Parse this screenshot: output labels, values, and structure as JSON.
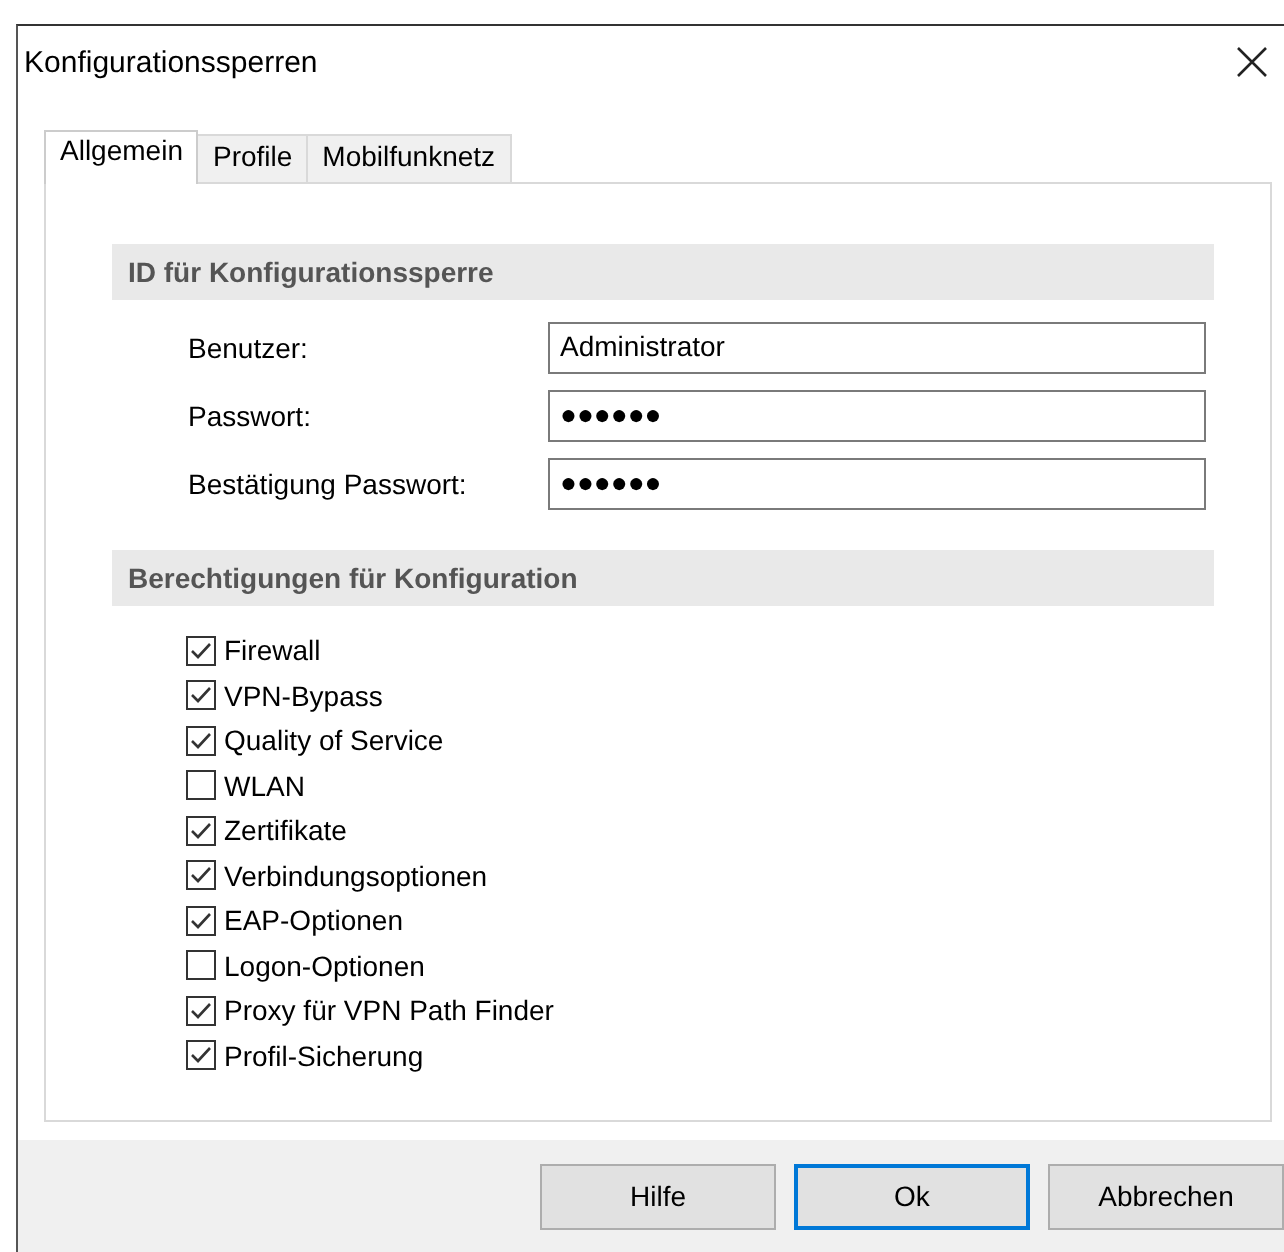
{
  "window": {
    "title": "Konfigurationssperren"
  },
  "tabs": [
    {
      "label": "Allgemein",
      "selected": true
    },
    {
      "label": "Profile",
      "selected": false
    },
    {
      "label": "Mobilfunknetz",
      "selected": false
    }
  ],
  "id_section": {
    "title": "ID für Konfigurationssperre",
    "fields": [
      {
        "label": "Benutzer:",
        "value": "Administrator"
      },
      {
        "label": "Passwort:",
        "value": "●●●●●●"
      },
      {
        "label": "Bestätigung Passwort:",
        "value": "●●●●●●"
      }
    ]
  },
  "permissions": {
    "title": "Berechtigungen für Konfiguration",
    "items": [
      {
        "label": "Firewall",
        "checked": true
      },
      {
        "label": "VPN-Bypass",
        "checked": true
      },
      {
        "label": "Quality of Service",
        "checked": true
      },
      {
        "label": "WLAN",
        "checked": false
      },
      {
        "label": "Zertifikate",
        "checked": true
      },
      {
        "label": "Verbindungsoptionen",
        "checked": true
      },
      {
        "label": "EAP-Optionen",
        "checked": true
      },
      {
        "label": "Logon-Optionen",
        "checked": false
      },
      {
        "label": "Proxy für VPN Path Finder",
        "checked": true
      },
      {
        "label": "Profil-Sicherung",
        "checked": true
      }
    ]
  },
  "buttons": [
    {
      "label": "Hilfe",
      "default": false
    },
    {
      "label": "Ok",
      "default": true
    },
    {
      "label": "Abbrechen",
      "default": false
    }
  ]
}
